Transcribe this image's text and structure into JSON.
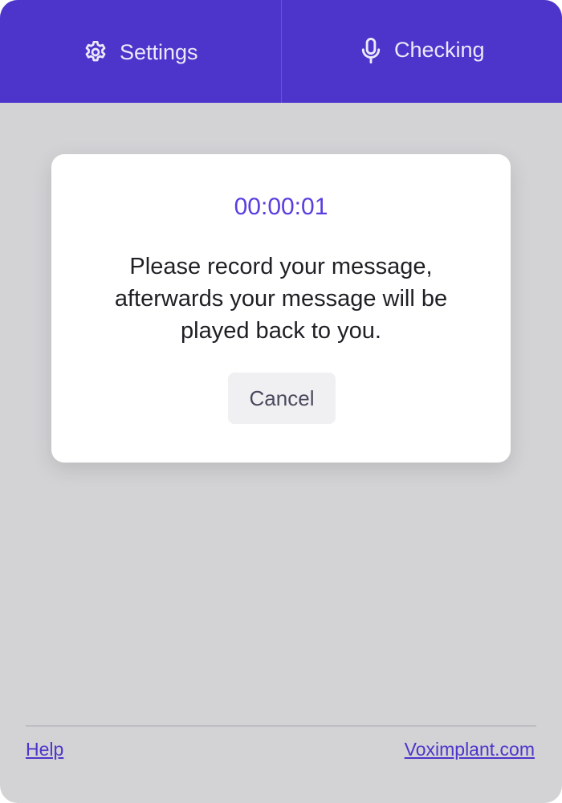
{
  "header": {
    "tabs": [
      {
        "label": "Settings",
        "icon": "gear-icon"
      },
      {
        "label": "Checking",
        "icon": "microphone-icon"
      }
    ]
  },
  "modal": {
    "timer": "00:00:01",
    "message": "Please record your message,\nafterwards your message will be\nplayed back to you.",
    "cancel_label": "Cancel"
  },
  "footer": {
    "help_label": "Help",
    "site_label": "Voximplant.com"
  },
  "colors": {
    "accent": "#4d35cb",
    "timer": "#5a3ee0",
    "background": "#d3d3d6"
  }
}
